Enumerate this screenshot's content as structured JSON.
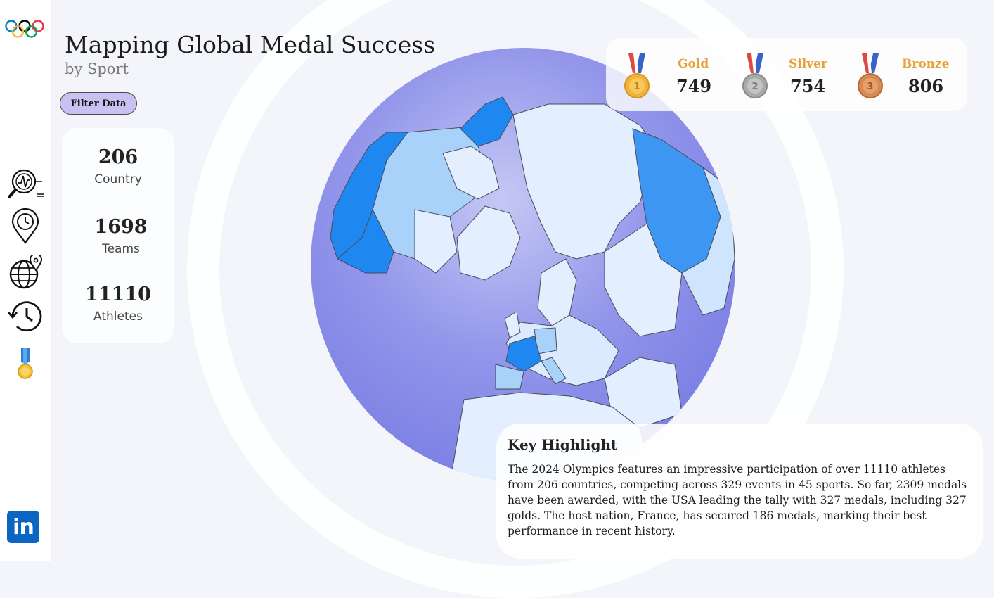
{
  "sidebar": {
    "logo_icon": "olympic-rings-icon",
    "items": [
      {
        "icon": "analytics-search-icon"
      },
      {
        "icon": "location-clock-icon"
      },
      {
        "icon": "globe-pin-icon"
      },
      {
        "icon": "history-icon"
      },
      {
        "icon": "medal-icon"
      }
    ],
    "linkedin_label": "in"
  },
  "header": {
    "title": "Mapping Global Medal Success",
    "subtitle": "by Sport"
  },
  "filter": {
    "label": "Filter Data"
  },
  "stats": [
    {
      "value": "206",
      "label": "Country"
    },
    {
      "value": "1698",
      "label": "Teams"
    },
    {
      "value": "11110",
      "label": "Athletes"
    }
  ],
  "medals": [
    {
      "name": "Gold",
      "count": "749",
      "color": "#f2b33d",
      "rank": "1"
    },
    {
      "name": "Silver",
      "count": "754",
      "color": "#a9a9a9",
      "rank": "2"
    },
    {
      "name": "Bronze",
      "count": "806",
      "color": "#d98a52",
      "rank": "3"
    }
  ],
  "map": {
    "ocean_color": "#8487e6",
    "land_light": "#e3efff",
    "land_mid": "#a9d2fb",
    "land_dark": "#1e88f0"
  },
  "highlight": {
    "title": "Key Highlight",
    "text": "The 2024 Olympics features an impressive participation of over 11110 athletes from 206 countries, competing across 329 events in 45 sports. So far, 2309 medals have been awarded, with the USA leading the tally with 327 medals, including 327 golds. The host nation, France, has secured 186 medals, marking their best performance in recent history."
  }
}
